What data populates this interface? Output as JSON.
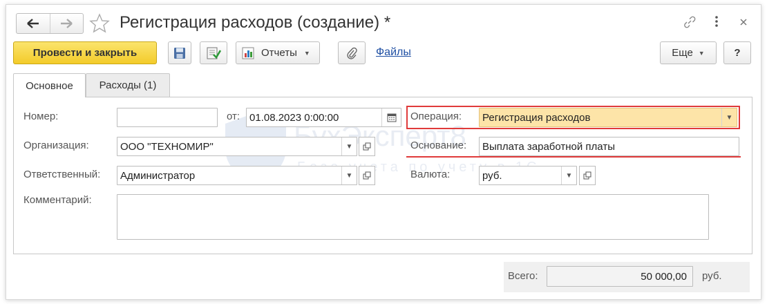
{
  "window": {
    "title": "Регистрация расходов (создание) *"
  },
  "header": {
    "back_icon": "arrow-left",
    "forward_icon": "arrow-right",
    "favorite_icon": "star-outline",
    "link_icon": "chain-link",
    "more_icon": "vertical-ellipsis",
    "close_icon": "close-x"
  },
  "toolbar": {
    "post_and_close_label": "Провести и закрыть",
    "reports_label": "Отчеты",
    "files_label": "Файлы",
    "more_label": "Еще",
    "help_label": "?"
  },
  "tabs": [
    {
      "label": "Основное",
      "active": true
    },
    {
      "label": "Расходы (1)",
      "active": false
    }
  ],
  "form": {
    "number_label": "Номер:",
    "number_value": "",
    "date_label": "от:",
    "date_value": "01.08.2023  0:00:00",
    "operation_label": "Операция:",
    "operation_value": "Регистрация расходов",
    "organization_label": "Организация:",
    "organization_value": "ООО \"ТЕХНОМИР\"",
    "basis_label": "Основание:",
    "basis_value": "Выплата заработной платы",
    "responsible_label": "Ответственный:",
    "responsible_value": "Администратор",
    "currency_label": "Валюта:",
    "currency_value": "руб.",
    "comment_label": "Комментарий:",
    "comment_value": ""
  },
  "footer": {
    "total_label": "Всего:",
    "total_value": "50 000,00",
    "total_unit": "руб."
  },
  "watermark": {
    "brand": "БухЭксперт8",
    "tagline": "База учета по учету в 1С"
  },
  "colors": {
    "primary_button": "#f3cb2a",
    "highlight_field": "#fde4a8",
    "annotation_red": "#e03a3a",
    "link": "#1f4fa3"
  }
}
